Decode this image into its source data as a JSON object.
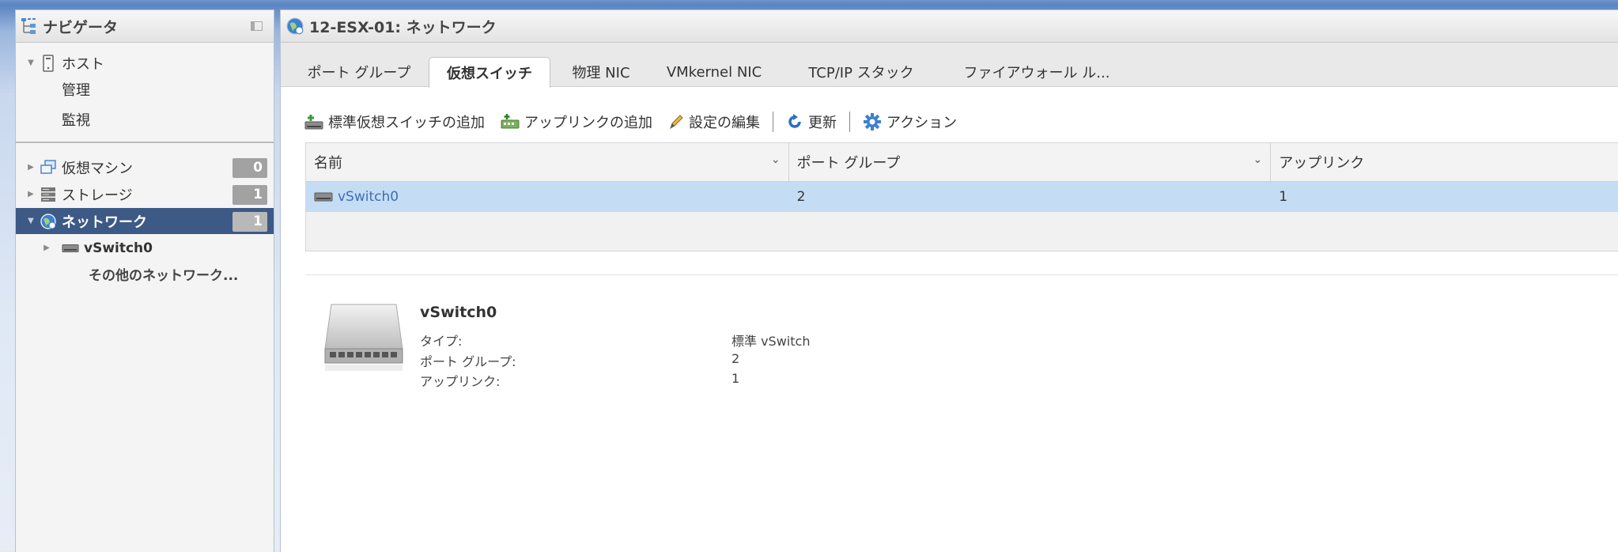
{
  "navigator": {
    "title": "ナビゲータ",
    "items": [
      {
        "label": "ホスト",
        "caret": "▼"
      },
      {
        "label": "管理"
      },
      {
        "label": "監視"
      },
      {
        "label": "仮想マシン",
        "badge": "0",
        "caret": "▶"
      },
      {
        "label": "ストレージ",
        "badge": "1",
        "caret": "▶"
      },
      {
        "label": "ネットワーク",
        "badge": "1",
        "caret": "▼"
      },
      {
        "label": "vSwitch0",
        "caret": "▶"
      },
      {
        "label": "その他のネットワーク..."
      }
    ]
  },
  "main": {
    "title": "12-ESX-01: ネットワーク",
    "tabs": [
      {
        "label": "ポート グループ"
      },
      {
        "label": "仮想スイッチ"
      },
      {
        "label": "物理 NIC"
      },
      {
        "label": "VMkernel NIC"
      },
      {
        "label": "TCP/IP スタック"
      },
      {
        "label": "ファイアウォール ル..."
      }
    ],
    "toolbar": {
      "add_switch": "標準仮想スイッチの追加",
      "add_uplink": "アップリンクの追加",
      "edit_settings": "設定の編集",
      "refresh": "更新",
      "actions": "アクション"
    },
    "grid": {
      "columns": [
        "名前",
        "ポート グループ",
        "アップリンク"
      ],
      "rows": [
        {
          "name": "vSwitch0",
          "port_groups": "2",
          "uplinks": "1"
        }
      ]
    },
    "detail": {
      "title": "vSwitch0",
      "type_label": "タイプ:",
      "type_value": "標準 vSwitch",
      "pg_label": "ポート グループ:",
      "pg_value": "2",
      "uplink_label": "アップリンク:",
      "uplink_value": "1"
    }
  },
  "colors": {
    "selected_nav": "#3d5a86",
    "selected_row": "#c5dcf5",
    "link": "#3d6fb3"
  }
}
